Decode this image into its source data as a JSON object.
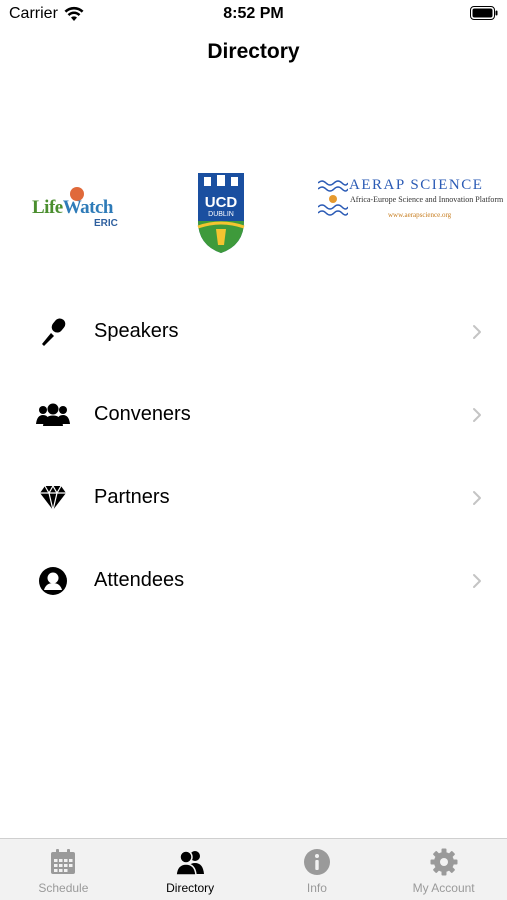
{
  "status_bar": {
    "carrier": "Carrier",
    "time": "8:52 PM",
    "wifi_icon": "wifi-icon",
    "battery_icon": "battery-icon"
  },
  "nav": {
    "title": "Directory"
  },
  "logos": {
    "lifewatch": {
      "word_a": "Life",
      "word_b": "Watch",
      "suffix": "ERIC"
    },
    "ucd": {
      "line1": "UCD",
      "line2": "DUBLIN"
    },
    "aerap": {
      "title": "AERAP SCIENCE",
      "subtitle": "Africa-Europe Science and Innovation Platform",
      "url": "www.aerapscience.org"
    }
  },
  "menu": {
    "items": [
      {
        "label": "Speakers",
        "icon": "microphone-icon"
      },
      {
        "label": "Conveners",
        "icon": "group-icon"
      },
      {
        "label": "Partners",
        "icon": "diamond-icon"
      },
      {
        "label": "Attendees",
        "icon": "person-circle-icon"
      }
    ]
  },
  "tab_bar": {
    "tabs": [
      {
        "label": "Schedule",
        "icon": "calendar-icon",
        "active": false
      },
      {
        "label": "Directory",
        "icon": "people-icon",
        "active": true
      },
      {
        "label": "Info",
        "icon": "info-icon",
        "active": false
      },
      {
        "label": "My Account",
        "icon": "gear-icon",
        "active": false
      }
    ]
  },
  "colors": {
    "accent": "#000000",
    "inactive_tab": "#9a9a9a",
    "tab_bar_bg": "#f2f2f2",
    "chevron": "#c4c4c4"
  }
}
